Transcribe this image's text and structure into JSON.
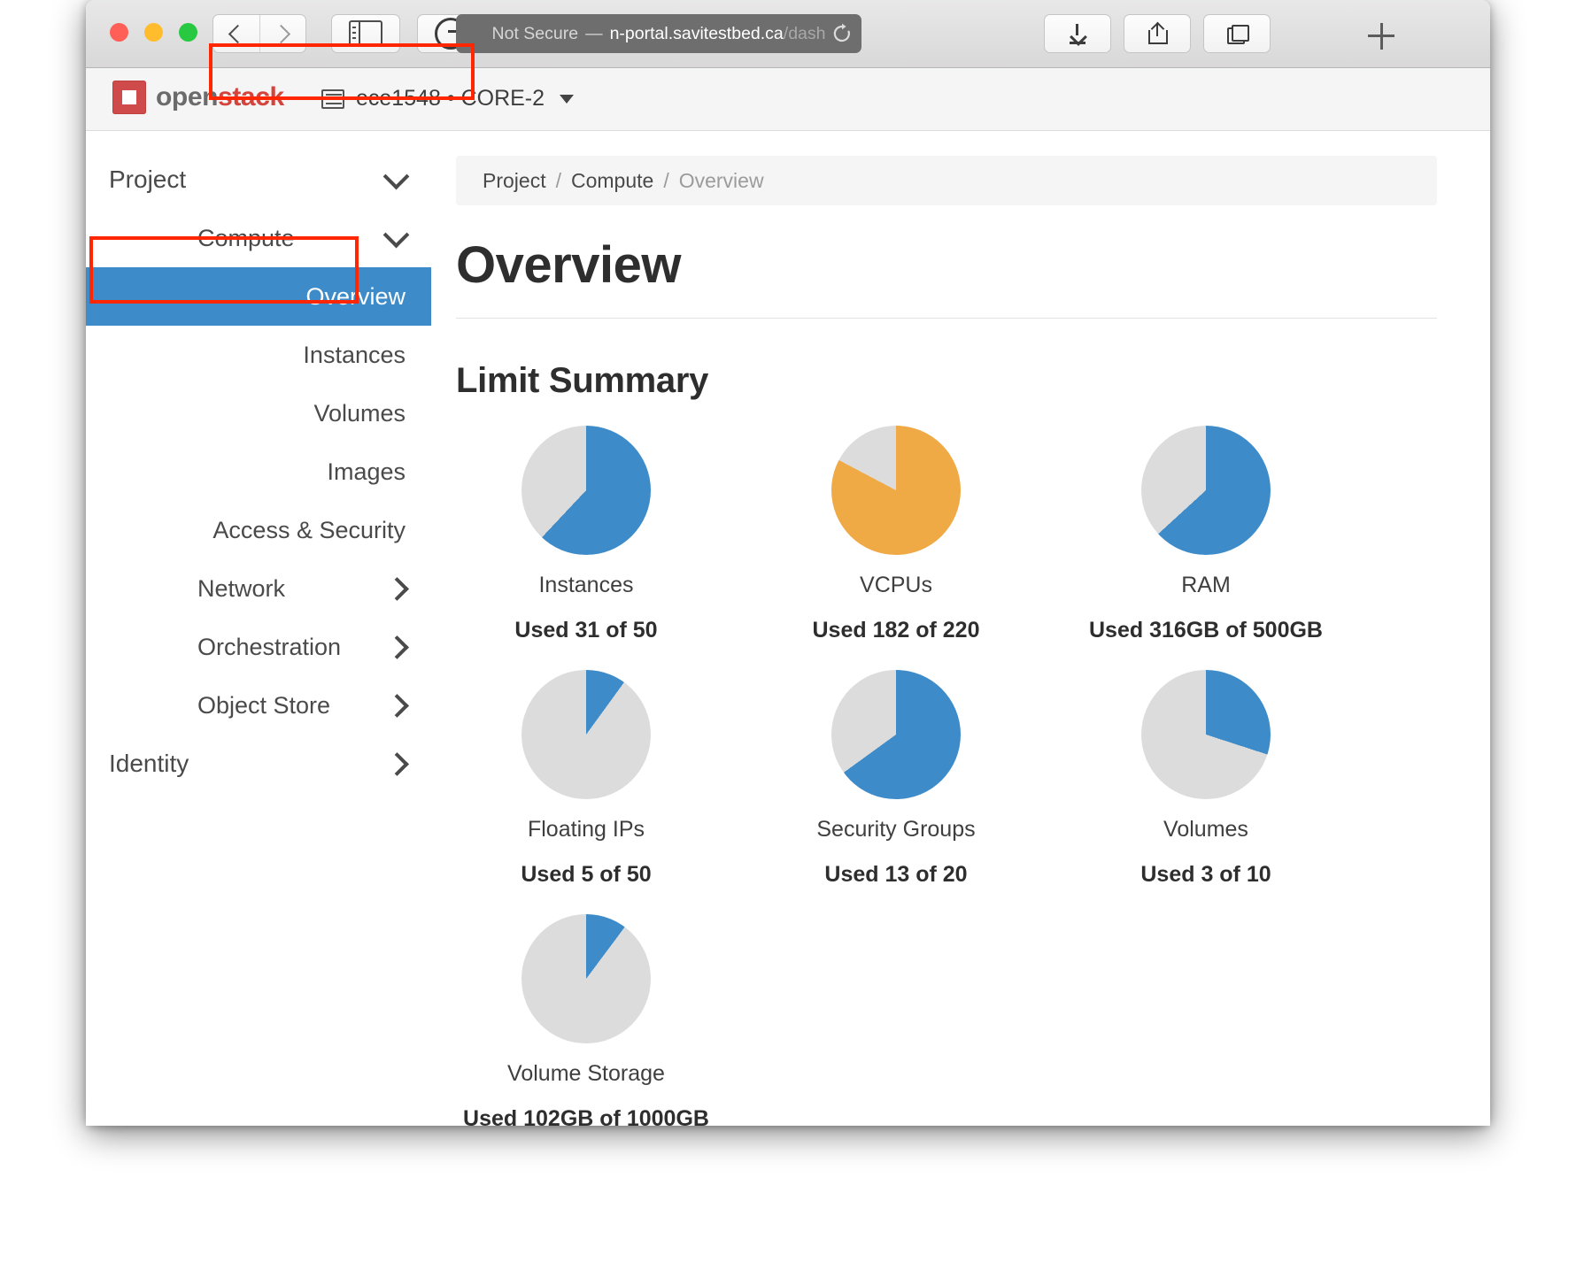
{
  "browser": {
    "traffic_lights": [
      "close",
      "minimize",
      "maximize"
    ],
    "url_security_label": "Not Secure",
    "url_separator": "—",
    "url_host": "n-portal.savitestbed.ca",
    "url_path": "/dash",
    "url_full": "Not Secure — n-portal.savitestbed.ca/dash"
  },
  "topbar": {
    "brand_open": "open",
    "brand_stack": "stack",
    "project_selector": "ece1548 • CORE-2"
  },
  "sidebar": {
    "items": [
      {
        "label": "Project",
        "level": 1,
        "icon": "chevron-down-icon",
        "active": false
      },
      {
        "label": "Compute",
        "level": 2,
        "icon": "chevron-down-icon",
        "active": false
      },
      {
        "label": "Overview",
        "level": 3,
        "icon": "",
        "active": true
      },
      {
        "label": "Instances",
        "level": 3,
        "icon": "",
        "active": false
      },
      {
        "label": "Volumes",
        "level": 3,
        "icon": "",
        "active": false
      },
      {
        "label": "Images",
        "level": 3,
        "icon": "",
        "active": false
      },
      {
        "label": "Access & Security",
        "level": 3,
        "icon": "",
        "active": false
      },
      {
        "label": "Network",
        "level": 2,
        "icon": "chevron-right-icon",
        "active": false
      },
      {
        "label": "Orchestration",
        "level": 2,
        "icon": "chevron-right-icon",
        "active": false
      },
      {
        "label": "Object Store",
        "level": 2,
        "icon": "chevron-right-icon",
        "active": false
      },
      {
        "label": "Identity",
        "level": 1,
        "icon": "chevron-right-icon",
        "active": false
      }
    ]
  },
  "main": {
    "breadcrumb": [
      "Project",
      "Compute",
      "Overview"
    ],
    "breadcrumb_separator": "/",
    "page_title": "Overview",
    "section_title": "Limit Summary"
  },
  "colors": {
    "used_blue": "#3e8bca",
    "used_orange": "#efa945",
    "remaining_gray": "#dcdcdc",
    "annotation_red": "#ff2600",
    "brand_red": "#d4433c",
    "sidebar_active": "#3e8bca"
  },
  "chart_data": [
    {
      "type": "pie",
      "title": "Instances",
      "used_label": "Used 31 of 50",
      "used": 31,
      "total": 50,
      "percent": 62,
      "unit": "",
      "slices": [
        {
          "name": "Used",
          "value": 31,
          "color": "#3e8bca"
        },
        {
          "name": "Remaining",
          "value": 19,
          "color": "#dcdcdc"
        }
      ]
    },
    {
      "type": "pie",
      "title": "VCPUs",
      "used_label": "Used 182 of 220",
      "used": 182,
      "total": 220,
      "percent": 82.7,
      "unit": "",
      "slices": [
        {
          "name": "Used",
          "value": 182,
          "color": "#efa945"
        },
        {
          "name": "Remaining",
          "value": 38,
          "color": "#dcdcdc"
        }
      ]
    },
    {
      "type": "pie",
      "title": "RAM",
      "used_label": "Used 316GB of 500GB",
      "used": 316,
      "total": 500,
      "percent": 63.2,
      "unit": "GB",
      "slices": [
        {
          "name": "Used",
          "value": 316,
          "color": "#3e8bca"
        },
        {
          "name": "Remaining",
          "value": 184,
          "color": "#dcdcdc"
        }
      ]
    },
    {
      "type": "pie",
      "title": "Floating IPs",
      "used_label": "Used 5 of 50",
      "used": 5,
      "total": 50,
      "percent": 10,
      "unit": "",
      "slices": [
        {
          "name": "Used",
          "value": 5,
          "color": "#3e8bca"
        },
        {
          "name": "Remaining",
          "value": 45,
          "color": "#dcdcdc"
        }
      ]
    },
    {
      "type": "pie",
      "title": "Security Groups",
      "used_label": "Used 13 of 20",
      "used": 13,
      "total": 20,
      "percent": 65,
      "unit": "",
      "slices": [
        {
          "name": "Used",
          "value": 13,
          "color": "#3e8bca"
        },
        {
          "name": "Remaining",
          "value": 7,
          "color": "#dcdcdc"
        }
      ]
    },
    {
      "type": "pie",
      "title": "Volumes",
      "used_label": "Used 3 of 10",
      "used": 3,
      "total": 10,
      "percent": 30,
      "unit": "",
      "slices": [
        {
          "name": "Used",
          "value": 3,
          "color": "#3e8bca"
        },
        {
          "name": "Remaining",
          "value": 7,
          "color": "#dcdcdc"
        }
      ]
    },
    {
      "type": "pie",
      "title": "Volume Storage",
      "used_label": "Used 102GB of 1000GB",
      "used": 102,
      "total": 1000,
      "percent": 10.2,
      "unit": "GB",
      "slices": [
        {
          "name": "Used",
          "value": 102,
          "color": "#3e8bca"
        },
        {
          "name": "Remaining",
          "value": 898,
          "color": "#dcdcdc"
        }
      ]
    }
  ]
}
